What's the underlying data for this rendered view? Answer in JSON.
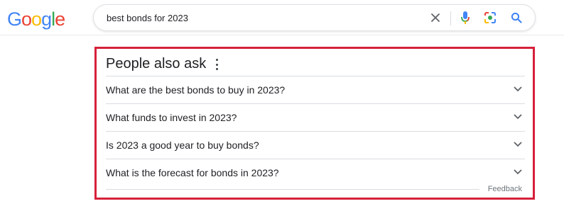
{
  "logo": {
    "letters": [
      "G",
      "o",
      "o",
      "g",
      "l",
      "e"
    ],
    "colors": [
      "#4285F4",
      "#EA4335",
      "#FBBC05",
      "#4285F4",
      "#34A853",
      "#EA4335"
    ]
  },
  "search": {
    "query": "best bonds for 2023"
  },
  "icons": {
    "clear": "close-icon",
    "mic": "mic-icon",
    "lens": "camera-lens-icon",
    "search": "search-icon"
  },
  "paa": {
    "title": "People also ask",
    "questions": [
      "What are the best bonds to buy in 2023?",
      "What funds to invest in 2023?",
      "Is 2023 a good year to buy bonds?",
      "What is the forecast for bonds in 2023?"
    ],
    "feedback": "Feedback",
    "highlight_color": "#d6203a"
  }
}
